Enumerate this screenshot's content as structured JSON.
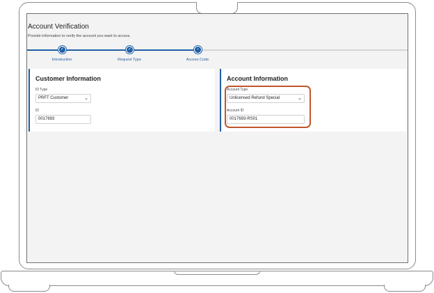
{
  "page": {
    "title": "Account Verification",
    "subtitle": "Provide information to verify the account you want to access."
  },
  "steps": [
    {
      "label": "Introduction",
      "state": "complete",
      "icon": "check-icon"
    },
    {
      "label": "Request Type",
      "state": "complete",
      "icon": "check-icon"
    },
    {
      "label": "Access Code",
      "state": "current",
      "icon": "chevron-right-icon"
    }
  ],
  "customer": {
    "heading": "Customer Information",
    "id_type_label": "ID Type",
    "id_type_value": "PRFT Customer",
    "id_label": "ID",
    "id_value": "0017693"
  },
  "account": {
    "heading": "Account Information",
    "type_label": "Account Type",
    "type_value": "Unlicensed Refund Special",
    "id_label": "Account ID",
    "id_value": "0017693-RS01"
  },
  "colors": {
    "accent": "#1f5fa6",
    "highlight": "#c0552b"
  }
}
